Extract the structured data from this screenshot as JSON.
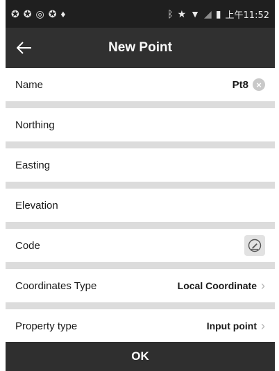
{
  "statusbar": {
    "left_icons": [
      "sync-icon",
      "sync-icon",
      "record-icon",
      "sync-icon",
      "location-pin-icon"
    ],
    "right_icons": [
      "bluetooth-icon",
      "star-icon",
      "wifi-icon",
      "signal-icon",
      "battery-icon"
    ],
    "time": "上午11:52"
  },
  "appbar": {
    "title": "New Point"
  },
  "fields": {
    "name": {
      "label": "Name",
      "value": "Pt8"
    },
    "northing": {
      "label": "Northing"
    },
    "easting": {
      "label": "Easting"
    },
    "elevation": {
      "label": "Elevation"
    },
    "code": {
      "label": "Code"
    },
    "coordinates_type": {
      "label": "Coordinates Type",
      "value": "Local Coordinate"
    },
    "property_type": {
      "label": "Property type",
      "value": "Input point"
    }
  },
  "ok_label": "OK"
}
